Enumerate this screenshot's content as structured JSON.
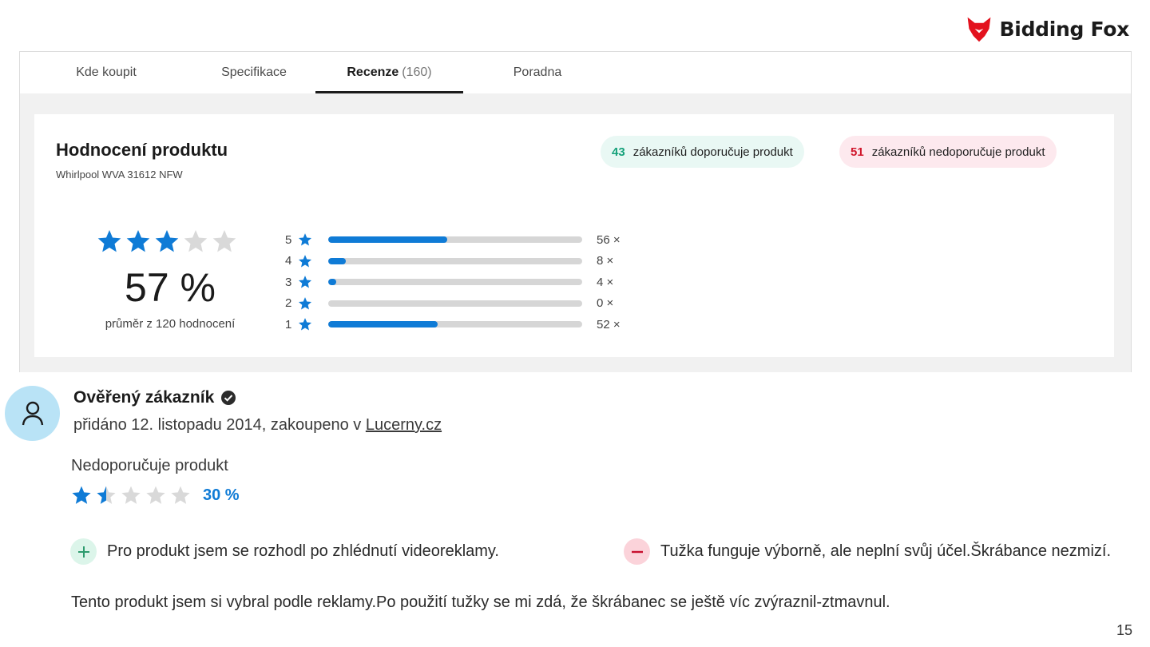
{
  "brand": {
    "name": "Bidding Fox",
    "color": "#e3121e"
  },
  "tabs": [
    {
      "label": "Kde koupit"
    },
    {
      "label": "Specifikace"
    },
    {
      "label": "Recenze",
      "count": "(160)",
      "active": true
    },
    {
      "label": "Poradna"
    }
  ],
  "rating": {
    "title": "Hodnocení produktu",
    "product": "Whirlpool WVA 31612 NFW",
    "recommend": {
      "count": "43",
      "text": "zákazníků doporučuje produkt"
    },
    "not_recommend": {
      "count": "51",
      "text": "zákazníků nedoporučuje produkt"
    },
    "stars_filled": 3,
    "stars_total": 5,
    "percent": "57 %",
    "average_text": "průměr z 120 hodnocení",
    "distribution": [
      {
        "stars": "5",
        "count": "56 ×",
        "fill": 0.47
      },
      {
        "stars": "4",
        "count": "8 ×",
        "fill": 0.07
      },
      {
        "stars": "3",
        "count": "4 ×",
        "fill": 0.03
      },
      {
        "stars": "2",
        "count": "0 ×",
        "fill": 0.0
      },
      {
        "stars": "1",
        "count": "52 ×",
        "fill": 0.43
      }
    ]
  },
  "review": {
    "author": "Ověřený zákazník",
    "added_prefix": "přidáno 12. listopadu 2014, zakoupeno v ",
    "shop": "Lucerny.cz",
    "verdict": "Nedoporučuje produkt",
    "stars_value": 1.5,
    "percent": "30 %",
    "pro": "Pro produkt jsem se rozhodl po zhlédnutí videoreklamy.",
    "con": "Tužka funguje výborně, ale neplní svůj účel.Škrábance nezmizí.",
    "text": "Tento produkt jsem si vybral podle reklamy.Po použití tužky se mi zdá, že škrábanec se ještě víc zvýraznil-ztmavnul."
  },
  "page_number": "15",
  "colors": {
    "accent": "#0f7bd6",
    "star_empty": "#d9d9d9",
    "green": "#15a17a",
    "red": "#d0172c"
  }
}
